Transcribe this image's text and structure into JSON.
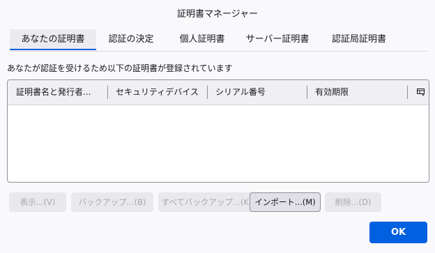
{
  "window": {
    "title": "証明書マネージャー"
  },
  "tabs": [
    {
      "label": "あなたの証明書",
      "selected": true
    },
    {
      "label": "認証の決定",
      "selected": false
    },
    {
      "label": "個人証明書",
      "selected": false
    },
    {
      "label": "サーバー証明書",
      "selected": false
    },
    {
      "label": "認証局証明書",
      "selected": false
    }
  ],
  "description": "あなたが認証を受けるため以下の証明書が登録されています",
  "table": {
    "columns": [
      "証明書名と発行者...",
      "セキュリティデバイス",
      "シリアル番号",
      "有効期限"
    ],
    "column_picker_icon": "column-picker-icon",
    "rows": []
  },
  "buttons": [
    {
      "label": "表示...(V)",
      "enabled": false
    },
    {
      "label": "バックアップ...(B)",
      "enabled": false
    },
    {
      "label": "すべてバックアップ...(K)",
      "enabled": false
    },
    {
      "label": "インポート...(M)",
      "enabled": true
    },
    {
      "label": "削除...(D)",
      "enabled": false
    }
  ],
  "ok_button": {
    "label": "OK"
  },
  "colors": {
    "accent": "#0061e0",
    "background": "#f9f9fb",
    "disabled_text": "#a6a6ad"
  }
}
